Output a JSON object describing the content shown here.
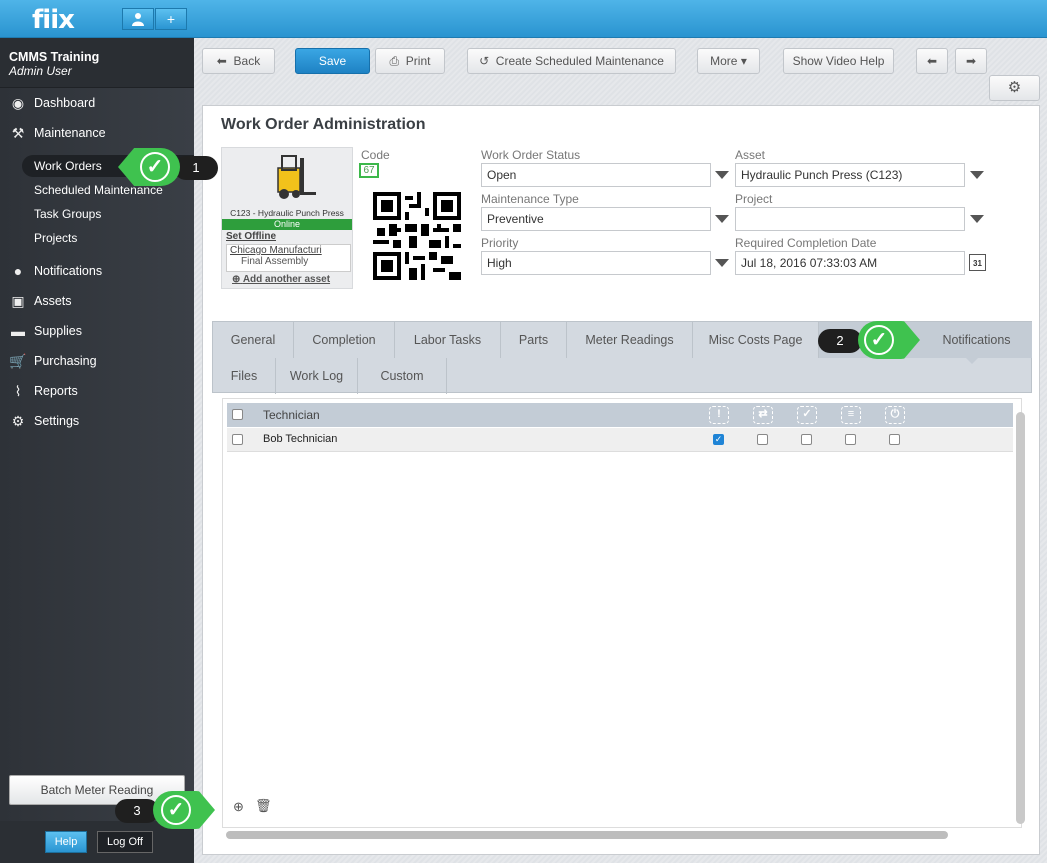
{
  "app": {
    "logo": "fiix",
    "add_icon": "+"
  },
  "account": {
    "company": "CMMS Training",
    "user": "Admin User"
  },
  "nav": {
    "dashboard": "Dashboard",
    "maintenance": "Maintenance",
    "work_orders": "Work Orders",
    "scheduled": "Scheduled Maintenance",
    "task_groups": "Task Groups",
    "projects": "Projects",
    "notifications": "Notifications",
    "assets": "Assets",
    "supplies": "Supplies",
    "purchasing": "Purchasing",
    "reports": "Reports",
    "settings": "Settings"
  },
  "sidebar_footer": {
    "batch": "Batch Meter Reading",
    "help": "Help",
    "logoff": "Log Off"
  },
  "toolbar": {
    "back": "Back",
    "save": "Save",
    "print": "Print",
    "create_sm": "Create Scheduled Maintenance",
    "more": "More",
    "video": "Show Video Help"
  },
  "page": {
    "title": "Work Order Administration"
  },
  "asset_card": {
    "name": "C123 - Hydraulic Punch Press",
    "status": "Online",
    "set_offline": "Set Offline",
    "location": "Chicago Manufacturi",
    "sublocation": "Final Assembly",
    "add_asset": "Add another asset"
  },
  "form": {
    "code_label": "Code",
    "code_value": "67",
    "status_label": "Work Order Status",
    "status_value": "Open",
    "asset_label": "Asset",
    "asset_value": "Hydraulic Punch Press (C123)",
    "mtype_label": "Maintenance Type",
    "mtype_value": "Preventive",
    "project_label": "Project",
    "project_value": "",
    "priority_label": "Priority",
    "priority_value": "High",
    "rcd_label": "Required Completion Date",
    "rcd_value": "Jul 18, 2016 07:33:03 AM",
    "cal_day": "31"
  },
  "tabs": {
    "row1": [
      "General",
      "Completion",
      "Labor Tasks",
      "Parts",
      "Meter Readings",
      "Misc Costs Page",
      "Notifications"
    ],
    "row2": [
      "Files",
      "Work Log",
      "Custom"
    ],
    "active": "Notifications"
  },
  "grid": {
    "header": "Technician",
    "rows": [
      {
        "name": "Bob Technician",
        "checks": [
          true,
          false,
          false,
          false,
          false
        ]
      }
    ]
  },
  "callouts": {
    "c1": "1",
    "c2": "2",
    "c3": "3"
  },
  "colors": {
    "accent": "#2a94d0",
    "callout": "#3fc24f",
    "online": "#2e9e3c"
  }
}
